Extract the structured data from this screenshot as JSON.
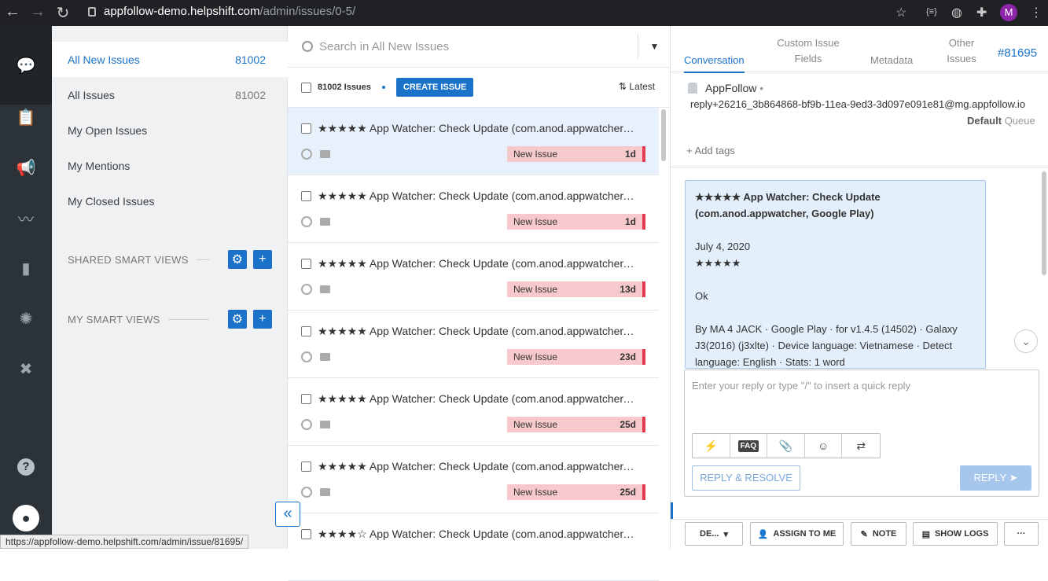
{
  "browser": {
    "url_host": "appfollow-demo.helpshift.com",
    "url_path": "/admin/issues/0-5/",
    "profile_initial": "M",
    "status_url": "https://appfollow-demo.helpshift.com/admin/issue/81695/"
  },
  "views": {
    "items": [
      {
        "label": "All New Issues",
        "count": "81002"
      },
      {
        "label": "All Issues",
        "count": "81002"
      },
      {
        "label": "My Open Issues",
        "count": ""
      },
      {
        "label": "My Mentions",
        "count": ""
      },
      {
        "label": "My Closed Issues",
        "count": ""
      }
    ],
    "shared_smart_views": "SHARED SMART VIEWS",
    "my_smart_views": "MY SMART VIEWS"
  },
  "list": {
    "search_placeholder": "Search in All New Issues",
    "issue_count": "81002 Issues",
    "create_label": "CREATE ISSUE",
    "sort_label": "Latest",
    "rows": [
      {
        "title": "★★★★★ App Watcher: Check Update (com.anod.appwatcher, G...",
        "status": "New Issue",
        "age": "1d"
      },
      {
        "title": "★★★★★ App Watcher: Check Update (com.anod.appwatcher, G...",
        "status": "New Issue",
        "age": "1d"
      },
      {
        "title": "★★★★★ App Watcher: Check Update (com.anod.appwatcher, G...",
        "status": "New Issue",
        "age": "13d"
      },
      {
        "title": "★★★★★ App Watcher: Check Update (com.anod.appwatcher, G...",
        "status": "New Issue",
        "age": "23d"
      },
      {
        "title": "★★★★★ App Watcher: Check Update (com.anod.appwatcher, G...",
        "status": "New Issue",
        "age": "25d"
      },
      {
        "title": "★★★★★ App Watcher: Check Update (com.anod.appwatcher, G...",
        "status": "New Issue",
        "age": "25d"
      },
      {
        "title": "★★★★☆ App Watcher: Check Update (com.anod.appwatcher, G...",
        "status": "",
        "age": ""
      }
    ]
  },
  "detail": {
    "tabs": {
      "conversation": "Conversation",
      "custom_1": "Custom Issue",
      "custom_2": "Fields",
      "metadata": "Metadata",
      "other_1": "Other",
      "other_2": "Issues",
      "issue_id": "#81695"
    },
    "requester": {
      "name": "AppFollow",
      "sep": "•",
      "email": "reply+26216_3b864868-bf9b-11ea-9ed3-3d097e091e81@mg.appfollow.io",
      "queue_name": "Default",
      "queue_label": "Queue"
    },
    "add_tags": "+ Add tags",
    "message": {
      "title": "★★★★★ App Watcher: Check Update (com.anod.appwatcher, Google Play)",
      "date": "July 4, 2020",
      "stars": "★★★★★",
      "body": "Ok",
      "meta": "By MA 4 JACK · Google Play · for v1.4.5 (14502) · Galaxy J3(2016) (j3xlte) · Device language: Vietnamese · Detect language: English · Stats: 1 word"
    },
    "reply_placeholder": "Enter your reply or type \"/\" to insert a quick reply",
    "faq_label": "FAQ",
    "reply_resolve": "REPLY & RESOLVE",
    "reply": "REPLY",
    "actions": {
      "status": "DE...",
      "assign": "ASSIGN TO ME",
      "note": "NOTE",
      "logs": "SHOW LOGS",
      "more": "···"
    }
  },
  "colors": {
    "accent": "#1a73c8",
    "badge_bg": "#f7c9cc",
    "badge_edge": "#e53950",
    "rail": "#2c3338"
  }
}
